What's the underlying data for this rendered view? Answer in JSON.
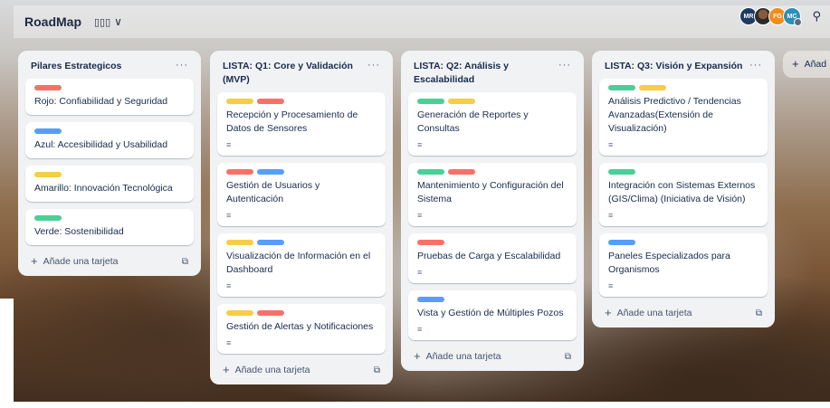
{
  "colors": {
    "red": "#f87168",
    "blue": "#579dff",
    "yellow": "#f5cd47",
    "green": "#4bce97"
  },
  "board": {
    "title": "RoadMap",
    "view_icon": "board-view-icon",
    "view_icon_glyph": "▯▯▯",
    "chevron": "∨"
  },
  "members": [
    {
      "initials": "MR",
      "name": "mr-avatar"
    },
    {
      "initials": "",
      "name": "photo-avatar"
    },
    {
      "initials": "FG",
      "name": "fg-avatar"
    },
    {
      "initials": "MC",
      "name": "mc-avatar"
    }
  ],
  "pin_icon": "⚲",
  "lists": [
    {
      "title": "Pilares Estrategicos",
      "menu": "···",
      "cards": [
        {
          "labels": [
            "red"
          ],
          "title": "Rojo: Confiabilidad y Seguridad",
          "desc": false
        },
        {
          "labels": [
            "blue"
          ],
          "title": "Azul: Accesibilidad y Usabilidad",
          "desc": false
        },
        {
          "labels": [
            "yellow"
          ],
          "title": "Amarillo: Innovación Tecnológica",
          "desc": false
        },
        {
          "labels": [
            "green"
          ],
          "title": "Verde: Sostenibilidad",
          "desc": false
        }
      ],
      "add_label": "Añade una tarjeta"
    },
    {
      "title": "LISTA: Q1: Core y Validación (MVP)",
      "menu": "···",
      "cards": [
        {
          "labels": [
            "yellow",
            "red"
          ],
          "title": "Recepción y Procesamiento de Datos de Sensores",
          "desc": true
        },
        {
          "labels": [
            "red",
            "blue"
          ],
          "title": "Gestión de Usuarios y Autenticación",
          "desc": true
        },
        {
          "labels": [
            "yellow",
            "blue"
          ],
          "title": "Visualización de Información en el Dashboard",
          "desc": true
        },
        {
          "labels": [
            "yellow",
            "red"
          ],
          "title": "Gestión de Alertas y Notificaciones",
          "desc": true
        }
      ],
      "add_label": "Añade una tarjeta"
    },
    {
      "title": "LISTA: Q2: Análisis y Escalabilidad",
      "menu": "···",
      "cards": [
        {
          "labels": [
            "green",
            "yellow"
          ],
          "title": "Generación de Reportes y Consultas",
          "desc": true
        },
        {
          "labels": [
            "green",
            "red"
          ],
          "title": "Mantenimiento y Configuración del Sistema",
          "desc": true
        },
        {
          "labels": [
            "red"
          ],
          "title": "Pruebas de Carga y Escalabilidad",
          "desc": true
        },
        {
          "labels": [
            "blue"
          ],
          "title": "Vista y Gestión de Múltiples Pozos",
          "desc": true
        }
      ],
      "add_label": "Añade una tarjeta"
    },
    {
      "title": "LISTA: Q3: Visión y Expansión",
      "menu": "···",
      "cards": [
        {
          "labels": [
            "green",
            "yellow"
          ],
          "title": "Análisis Predictivo / Tendencias Avanzadas(Extensión de Visualización)",
          "desc": true
        },
        {
          "labels": [
            "green"
          ],
          "title": "Integración con Sistemas Externos (GIS/Clima) (Iniciativa de Visión)",
          "desc": true
        },
        {
          "labels": [
            "blue"
          ],
          "title": "Paneles Especializados para Organismos",
          "desc": true
        }
      ],
      "add_label": "Añade una tarjeta"
    }
  ],
  "add_list_label": "Añad",
  "icons": {
    "plus": "+",
    "template": "⧉",
    "description": "≡"
  }
}
